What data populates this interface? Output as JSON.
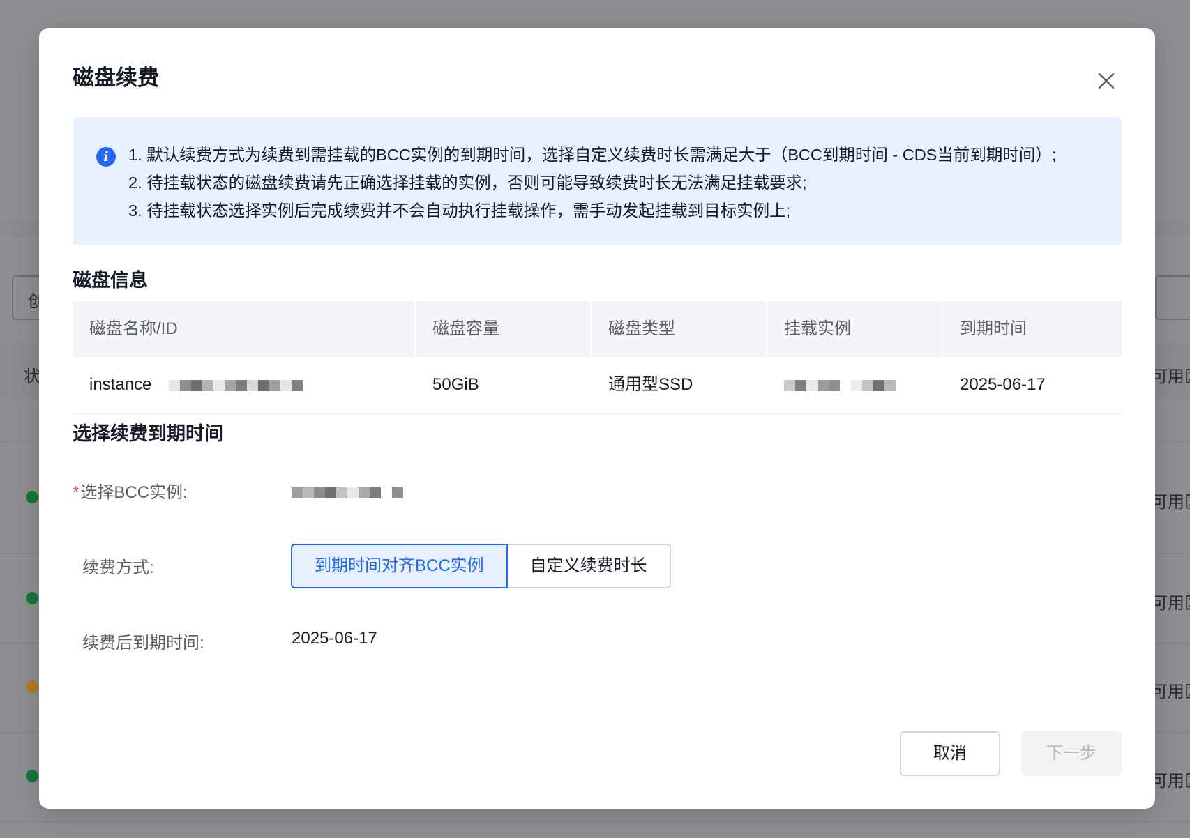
{
  "background": {
    "status_header": "状",
    "select_char": "创",
    "zone_label": "可用区"
  },
  "modal": {
    "title": "磁盘续费",
    "close_icon": "close-icon",
    "alert": {
      "icon": "info-icon",
      "lines": [
        "1. 默认续费方式为续费到需挂载的BCC实例的到期时间，选择自定义续费时长需满足大于（BCC到期时间 - CDS当前到期时间）;",
        "2. 待挂载状态的磁盘续费请先正确选择挂载的实例，否则可能导致续费时长无法满足挂载要求;",
        "3. 待挂载状态选择实例后完成续费并不会自动执行挂载操作，需手动发起挂载到目标实例上;"
      ]
    },
    "disk_info": {
      "section_title": "磁盘信息",
      "columns": [
        "磁盘名称/ID",
        "磁盘容量",
        "磁盘类型",
        "挂载实例",
        "到期时间"
      ],
      "row": {
        "name_prefix": "instance",
        "capacity": "50GiB",
        "type": "通用型SSD",
        "expire": "2025-06-17"
      }
    },
    "renew": {
      "section_title": "选择续费到期时间",
      "bcc_label": "选择BCC实例:",
      "required_mark": "*",
      "method_label": "续费方式:",
      "method_options": [
        "到期时间对齐BCC实例",
        "自定义续费时长"
      ],
      "selected_method": "到期时间对齐BCC实例",
      "after_label": "续费后到期时间:",
      "after_value": "2025-06-17"
    },
    "footer": {
      "cancel": "取消",
      "next": "下一步"
    }
  },
  "colors": {
    "accent": "#2468f2",
    "alert_bg": "#e6f0ff",
    "required": "#f33e3e",
    "overlay": "#8e8f93"
  }
}
